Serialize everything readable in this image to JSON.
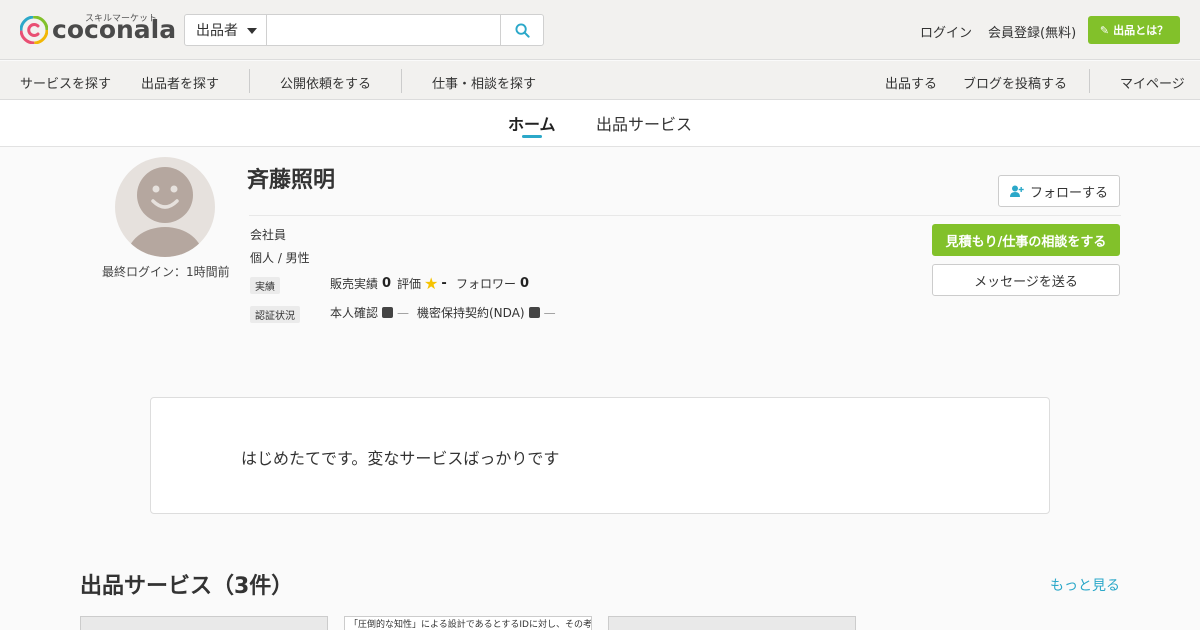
{
  "header": {
    "logo_sub": "スキルマーケット",
    "logo_word": "coconala",
    "search": {
      "select_label": "出品者",
      "placeholder": ""
    },
    "login": "ログイン",
    "register": "会員登録(無料)",
    "sell_label": "出品とは？"
  },
  "subnav": {
    "items_left": [
      "サービスを探す",
      "出品者を探す",
      "公開依頼をする",
      "仕事・相談を探す"
    ],
    "items_right": [
      "出品する",
      "ブログを投稿する",
      "マイページ"
    ]
  },
  "tabs": [
    "ホーム",
    "出品サービス"
  ],
  "profile": {
    "name": "斉藤照明",
    "last_login": "最終ログイン：1時間前",
    "occupation": "会社員",
    "type_gender": "個人 / 男性",
    "record_tag": "実績",
    "sales_label": "販売実績",
    "sales_value": "0",
    "rating_label": "評価",
    "rating_value": "-",
    "followers_label": "フォロワー",
    "followers_value": "0",
    "verify_tag": "認証状況",
    "identity_label": "本人確認",
    "identity_status": "—",
    "nda_label": "機密保持契約(NDA)",
    "nda_status": "—",
    "follow_label": "フォローする",
    "quote_label": "見積もり/仕事の相談をする",
    "message_label": "メッセージを送る"
  },
  "intro": "はじめたてです。変なサービスばっかりです",
  "services": {
    "title": "出品サービス（3件）",
    "more": "もっと見る",
    "card_caption": "「圧倒的な知性」による設計であるとするIDに対し、その考"
  },
  "colors": {
    "accent_green": "#82c12a",
    "link_blue": "#2ba8c9"
  }
}
